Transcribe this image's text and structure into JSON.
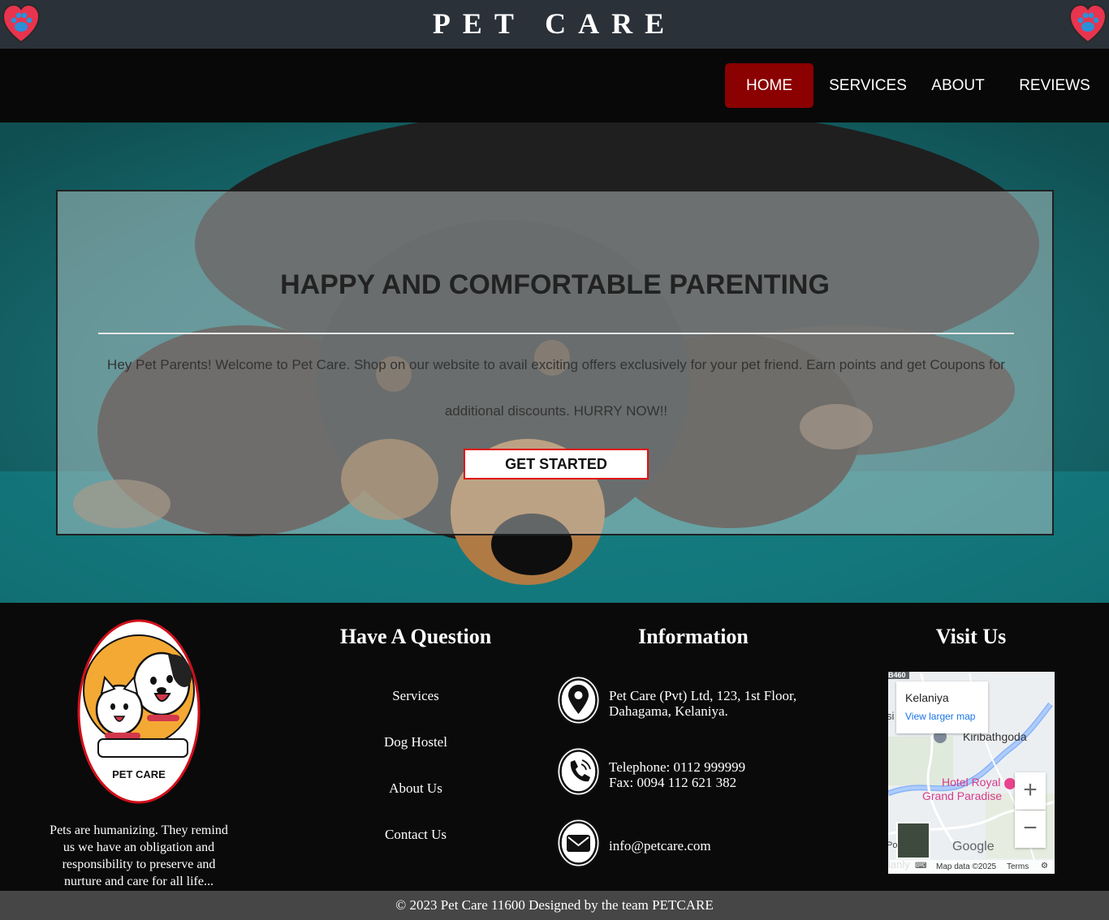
{
  "header": {
    "brand": "PET CARE"
  },
  "nav": [
    {
      "label": "HOME",
      "active": true
    },
    {
      "label": "SERVICES",
      "active": false
    },
    {
      "label": "ABOUT",
      "active": false
    },
    {
      "label": "REVIEWS",
      "active": false
    }
  ],
  "hero": {
    "title": "HAPPY AND COMFORTABLE PARENTING",
    "text": "Hey Pet Parents! Welcome to Pet Care. Shop on our website to avail exciting offers exclusively for your pet friend. Earn points and get Coupons for additional discounts. HURRY NOW!!",
    "cta": "GET STARTED"
  },
  "footer": {
    "logo_text": "PET CARE",
    "about_text": "Pets are humanizing. They remind us we have an obligation and responsibility to preserve and nurture and care for all life...",
    "question": {
      "title": "Have A Question",
      "links": [
        "Services",
        "Dog Hostel",
        "About Us",
        "Contact Us"
      ]
    },
    "information": {
      "title": "Information",
      "address_line1": "Pet Care (Pvt) Ltd, 123, 1st Floor,",
      "address_line2": "Dahagama, Kelaniya.",
      "telephone": "Telephone: 0112 999999",
      "fax": "Fax: 0094 112 621 382",
      "email": "info@petcare.com"
    },
    "visit": {
      "title": "Visit Us",
      "map": {
        "place": "Kelaniya",
        "larger_map": "View larger map",
        "road_label": "B460",
        "label_si": "si",
        "label_kiribathgoda": "Kiribathgoda",
        "label_hotel1": "Hotel Royal",
        "label_hotel2": "Grand Paradise",
        "label_po": "Po",
        "label_lanly": "lanly",
        "zoom_in": "+",
        "zoom_out": "−",
        "google": "Google",
        "map_data": "Map data ©2025",
        "terms": "Terms"
      }
    }
  },
  "copyright": "© 2023 Pet Care 11600 Designed by the team PETCARE",
  "colors": {
    "topbar": "#2b3139",
    "nav_active": "#8b0000",
    "cta_border": "#e01010",
    "bottom_bar": "#464646"
  }
}
